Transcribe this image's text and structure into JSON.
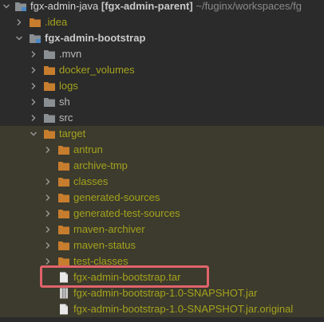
{
  "root": {
    "label": "fgx-admin-java",
    "module": "[fgx-admin-parent]",
    "path": "~/fuginx/workspaces/fg"
  },
  "items": [
    {
      "label": ".idea"
    },
    {
      "label": "fgx-admin-bootstrap"
    },
    {
      "label": ".mvn"
    },
    {
      "label": "docker_volumes"
    },
    {
      "label": "logs"
    },
    {
      "label": "sh"
    },
    {
      "label": "src"
    },
    {
      "label": "target"
    },
    {
      "label": "antrun"
    },
    {
      "label": "archive-tmp"
    },
    {
      "label": "classes"
    },
    {
      "label": "generated-sources"
    },
    {
      "label": "generated-test-sources"
    },
    {
      "label": "maven-archiver"
    },
    {
      "label": "maven-status"
    },
    {
      "label": "test-classes"
    },
    {
      "label": "fgx-admin-bootstrap.tar"
    },
    {
      "label": "fgx-admin-bootstrap-1.0-SNAPSHOT.jar"
    },
    {
      "label": "fgx-admin-bootstrap-1.0-SNAPSHOT.jar.original"
    }
  ],
  "colors": {
    "background": "#2b2b2b",
    "excluded_text": "#a5a21d",
    "folder": "#c77d2e",
    "highlight_box": "#e0636b"
  },
  "icons": {
    "expanded": "chevron-down-icon",
    "collapsed": "chevron-right-icon",
    "folder": "folder-icon",
    "module": "module-folder-icon",
    "file": "file-icon",
    "jar": "jar-file-icon"
  }
}
